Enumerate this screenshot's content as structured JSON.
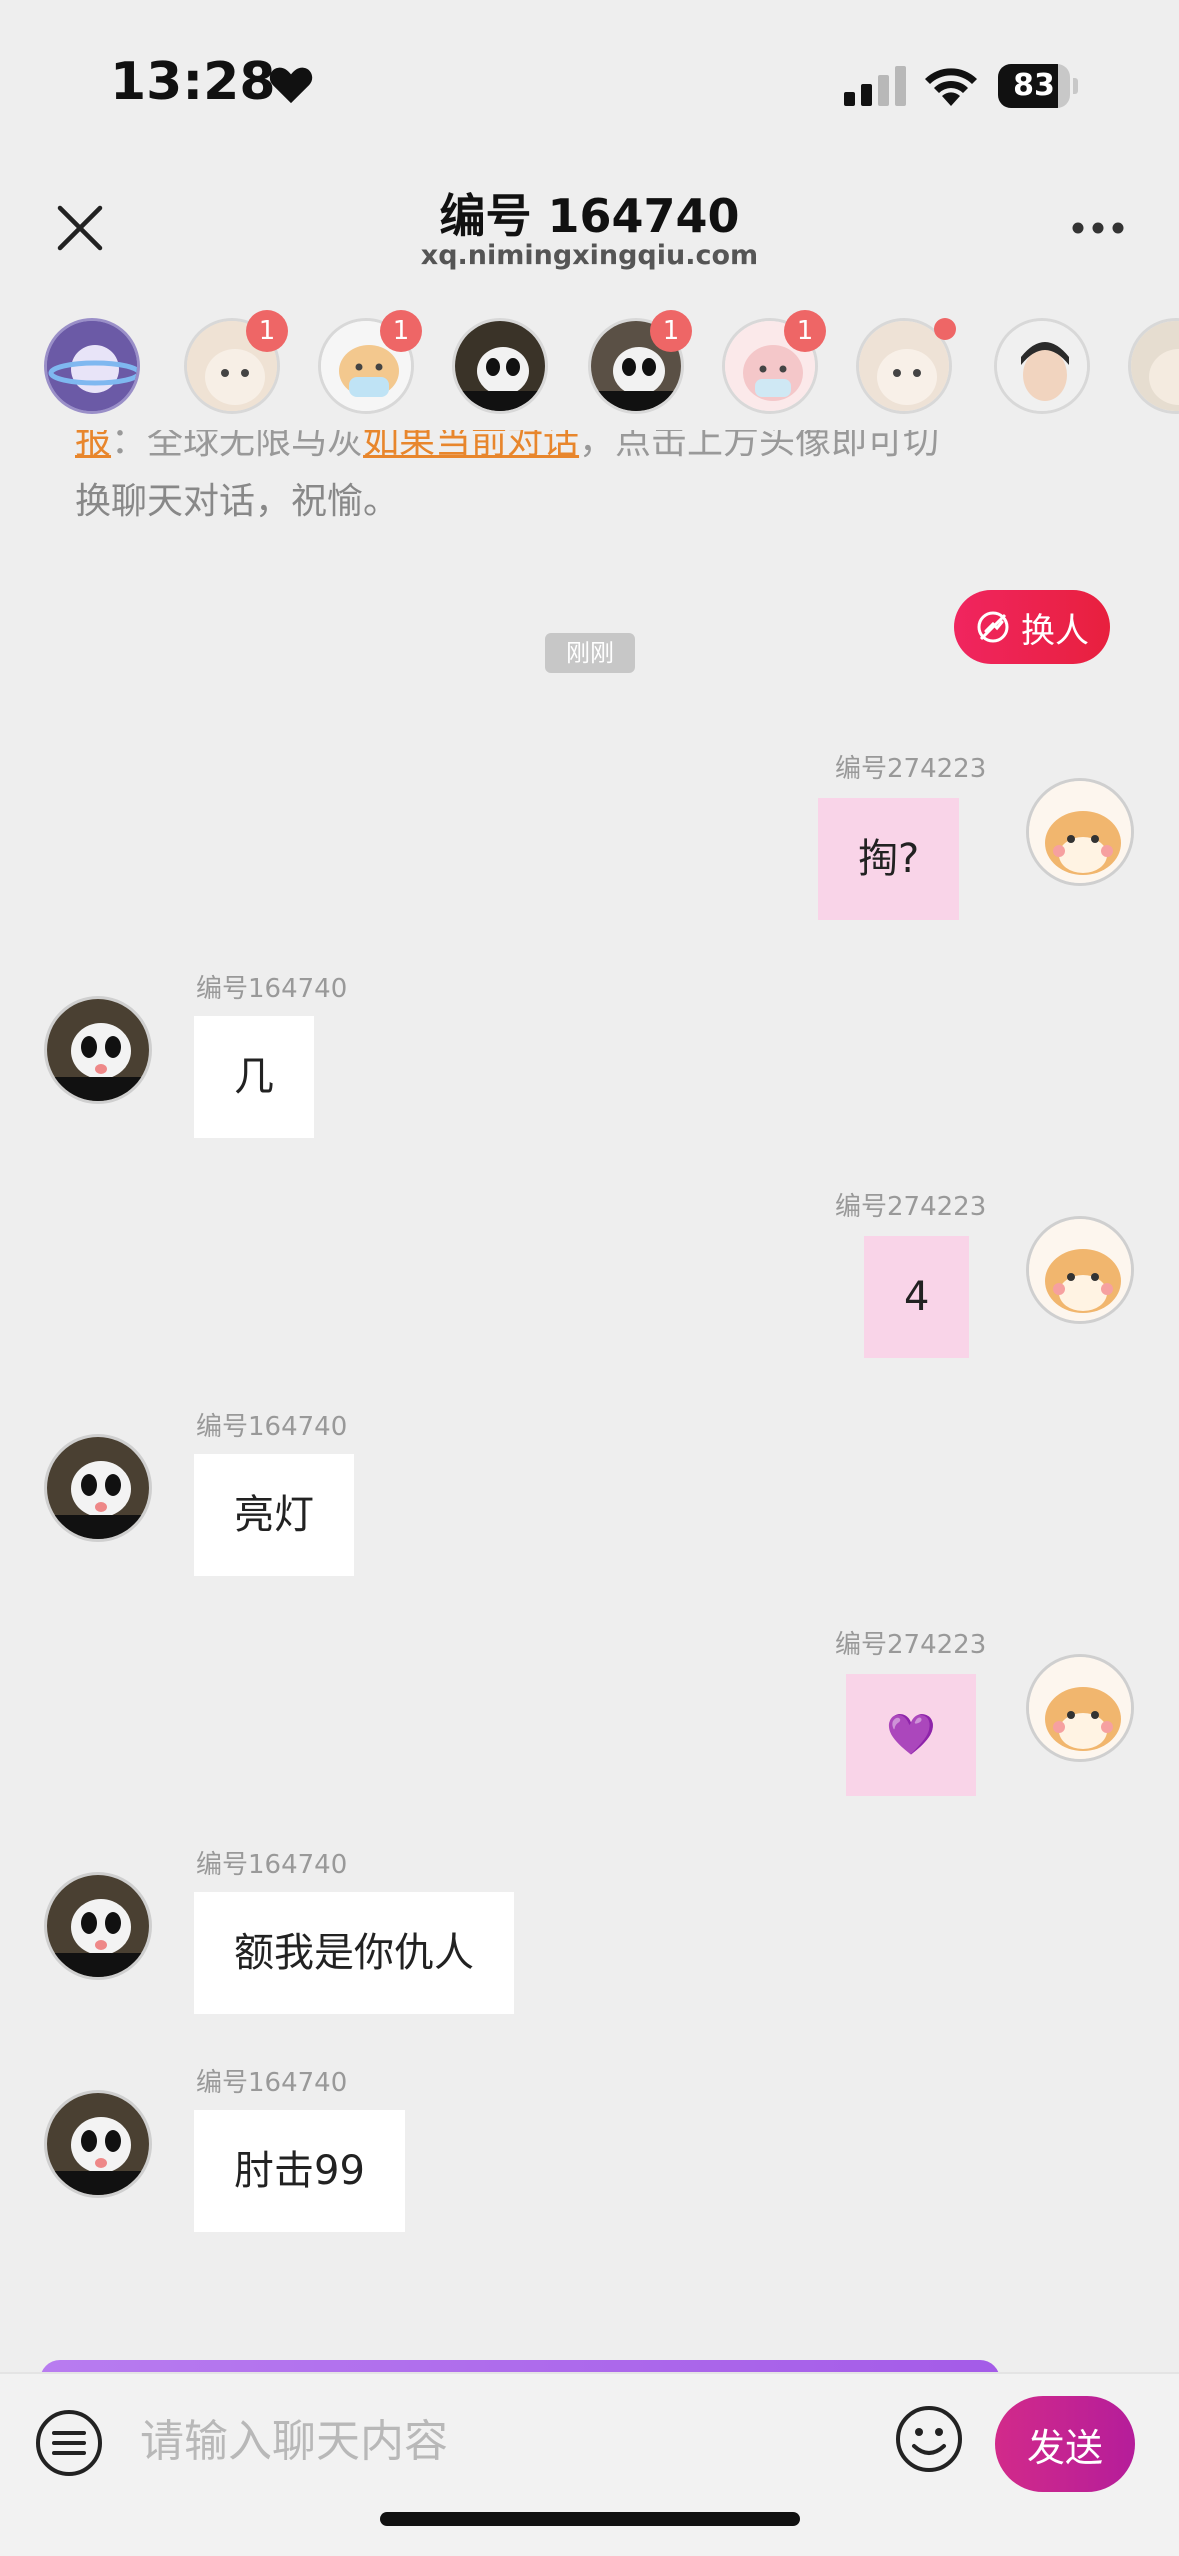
{
  "status_bar": {
    "time": "13:28",
    "battery": "83",
    "battery_level": 0.83
  },
  "header": {
    "title": "编号 164740",
    "url": "xq.nimingxingqiu.com"
  },
  "avatar_strip": {
    "avatars": [
      {
        "name": "planet",
        "badge": ""
      },
      {
        "name": "cat-1",
        "badge": "1"
      },
      {
        "name": "cat-mask",
        "badge": "1"
      },
      {
        "name": "panda-1",
        "badge": ""
      },
      {
        "name": "panda-2",
        "badge": "1"
      },
      {
        "name": "bear",
        "badge": "1"
      },
      {
        "name": "cat-2",
        "badge": "dot"
      },
      {
        "name": "person",
        "badge": ""
      },
      {
        "name": "cat-3",
        "badge": ""
      }
    ]
  },
  "notice": {
    "line1_a": "报",
    "line1_b": "：全球无限马灰",
    "line1_link": "如果当前对话",
    "line1_c": "，点击上方头像即可切",
    "line2": "换聊天对话，祝愉。"
  },
  "switch_button": {
    "label": "换人"
  },
  "timestamp": "刚刚",
  "messages": [
    {
      "side": "right",
      "name": "编号274223",
      "text": "掏?"
    },
    {
      "side": "left",
      "name": "编号164740",
      "text": "几"
    },
    {
      "side": "right",
      "name": "编号274223",
      "text": "4"
    },
    {
      "side": "left",
      "name": "编号164740",
      "text": "亮灯"
    },
    {
      "side": "right",
      "name": "编号274223",
      "text": "💜"
    },
    {
      "side": "left",
      "name": "编号164740",
      "text": "额我是你仇人"
    },
    {
      "side": "left",
      "name": "编号164740",
      "text": "肘击99"
    }
  ],
  "input": {
    "placeholder": "请输入聊天内容",
    "value": ""
  },
  "send_button": {
    "label": "发送"
  },
  "colors": {
    "accent": "#e8203e",
    "send": "#c0228f",
    "bubble_right": "#f9d4e8",
    "bubble_left": "#ffffff"
  }
}
